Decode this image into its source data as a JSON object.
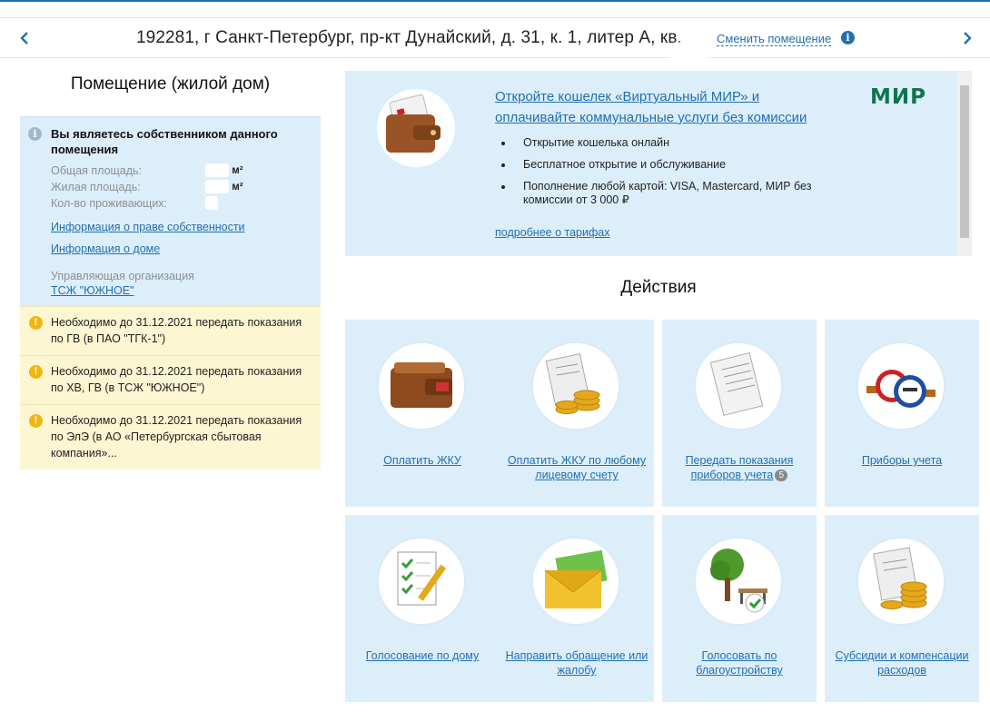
{
  "address_bar": {
    "address": "192281, г Санкт-Петербург, пр-кт Дунайский, д. 31, к. 1, литер А, кв.",
    "change_link": "Сменить помещение",
    "info_icon": "info-icon",
    "prev_icon": "chevron-left-icon",
    "next_icon": "chevron-right-icon"
  },
  "room": {
    "title": "Помещение (жилой дом)",
    "owner_title": "Вы являетесь собственником данного помещения",
    "props": [
      {
        "label": "Общая площадь:",
        "unit": "м²"
      },
      {
        "label": "Жилая площадь:",
        "unit": "м²"
      },
      {
        "label": "Кол-во проживающих:",
        "unit": ""
      }
    ],
    "links": [
      "Информация о праве собственности",
      "Информация о доме"
    ],
    "mgmt_label": "Управляющая организация",
    "mgmt_name": "ТСЖ \"ЮЖНОЕ\""
  },
  "notices": [
    "Необходимо до 31.12.2021 передать показания по ГВ (в ПАО \"ТГК-1\")",
    "Необходимо до 31.12.2021 передать показания по ХВ, ГВ (в ТСЖ \"ЮЖНОЕ\")",
    "Необходимо до 31.12.2021 передать показания по ЭлЭ (в АО «Петербургская сбытовая компания»..."
  ],
  "promo": {
    "title": "Откройте кошелек «Виртуальный МИР» и оплачивайте коммунальные услуги без комиссии",
    "items": [
      "Открытие кошелька онлайн",
      "Бесплатное открытие и обслуживание",
      "Пополнение любой картой: VISA, Mastercard, МИР без комиссии от 3 000 ₽"
    ],
    "more": "подробнее о тарифах",
    "logo": "МИР"
  },
  "actions": {
    "title": "Действия",
    "tiles": [
      {
        "label": "Оплатить ЖКУ",
        "icon": "wallet-icon",
        "badge": ""
      },
      {
        "label": "Оплатить ЖКУ по любому лицевому счету",
        "icon": "receipt-coins-icon",
        "badge": ""
      },
      {
        "label": "Передать показания приборов учета",
        "icon": "receipt-icon",
        "badge": "5"
      },
      {
        "label": "Приборы учета",
        "icon": "water-meter-icon",
        "badge": ""
      },
      {
        "label": "Голосование по дому",
        "icon": "checklist-icon",
        "badge": ""
      },
      {
        "label": "Направить обращение или жалобу",
        "icon": "envelope-icon",
        "badge": ""
      },
      {
        "label": "Голосовать по благоустройству",
        "icon": "tree-bench-icon",
        "badge": ""
      },
      {
        "label": "Субсидии и компенсации расходов",
        "icon": "subsidy-coins-icon",
        "badge": ""
      }
    ]
  },
  "colors": {
    "link": "#1f6fb3",
    "panel": "#ddeefb",
    "notice": "#fdf6d3",
    "warn": "#efb810",
    "mir": "#0f754e"
  }
}
